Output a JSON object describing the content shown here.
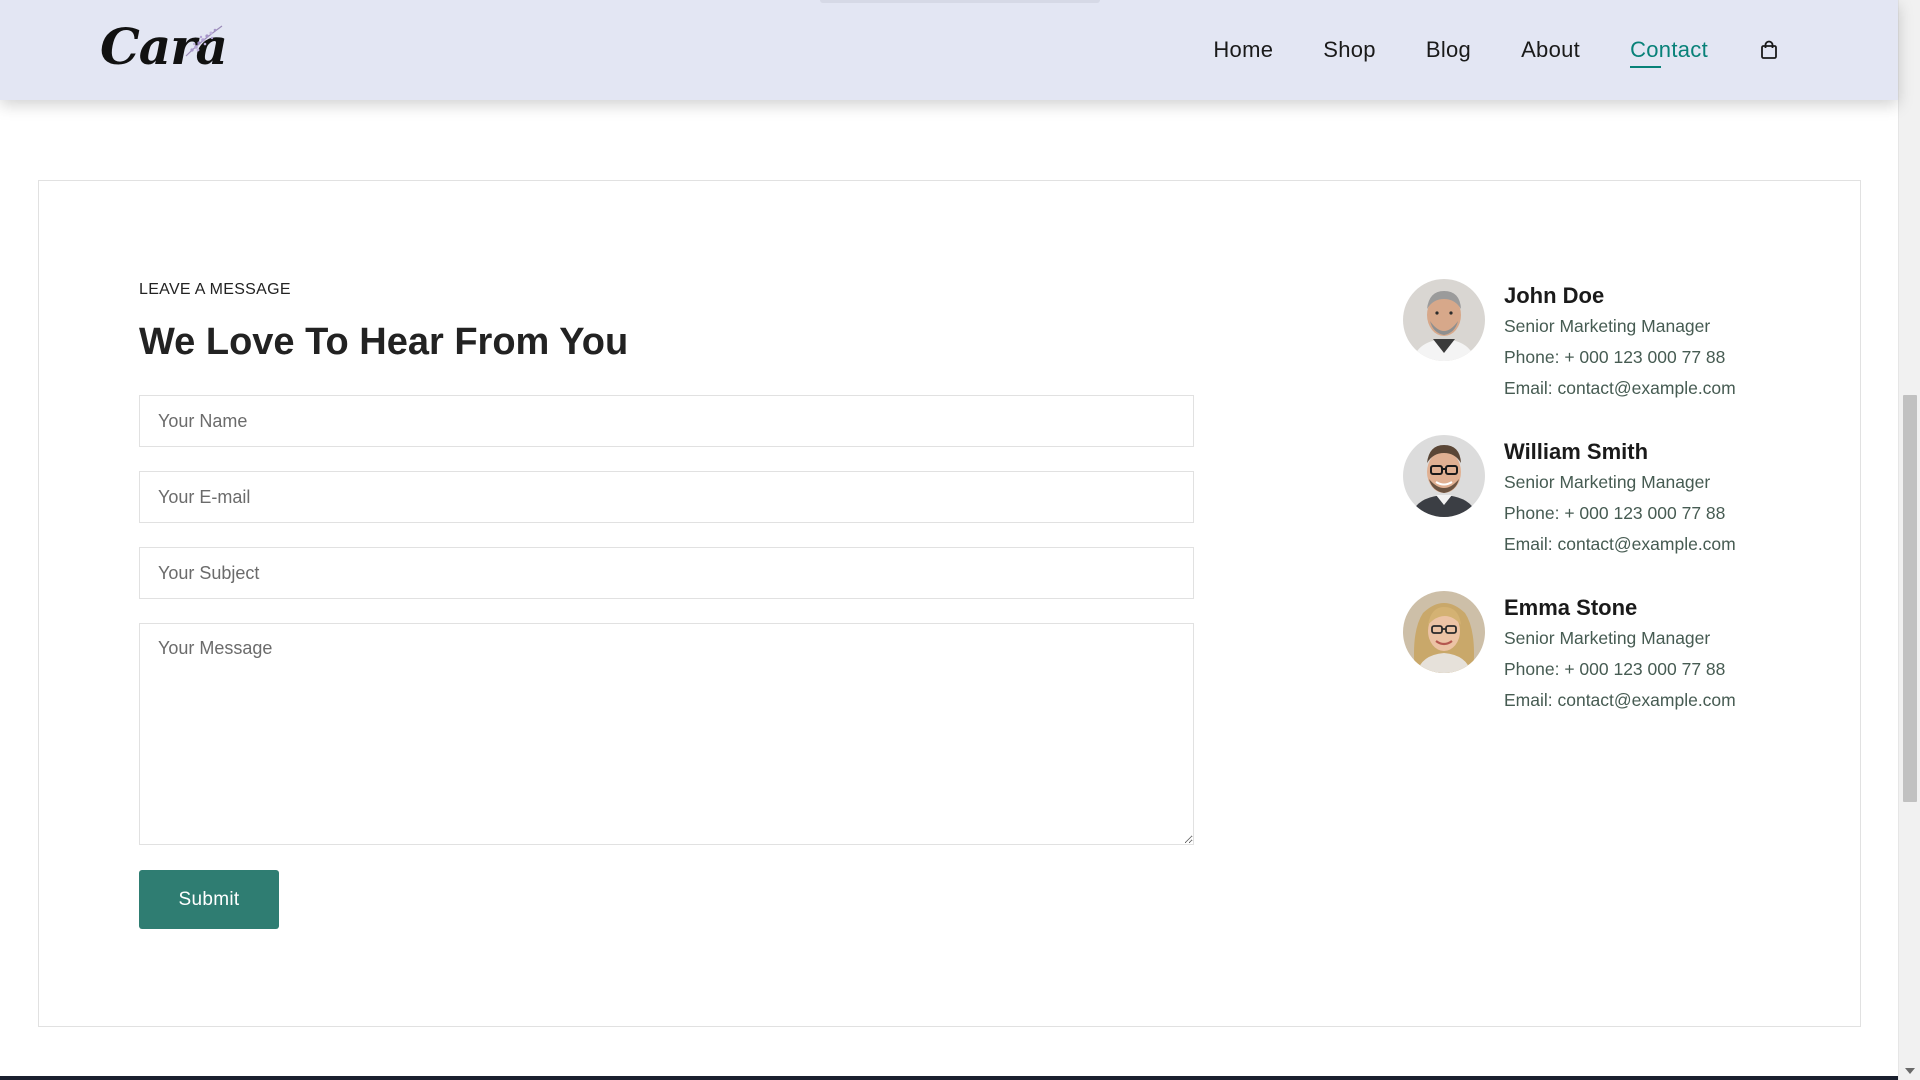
{
  "brand": {
    "logo_text": "Cara"
  },
  "nav": {
    "items": [
      {
        "label": "Home",
        "active": false
      },
      {
        "label": "Shop",
        "active": false
      },
      {
        "label": "Blog",
        "active": false
      },
      {
        "label": "About",
        "active": false
      },
      {
        "label": "Contact",
        "active": true
      }
    ],
    "cart_icon": "shopping-bag-icon"
  },
  "form": {
    "eyebrow": "LEAVE A MESSAGE",
    "title": "We Love To Hear From You",
    "name_placeholder": "Your Name",
    "email_placeholder": "Your E-mail",
    "subject_placeholder": "Your Subject",
    "message_placeholder": "Your Message",
    "submit_label": "Submit"
  },
  "people": [
    {
      "name": "John Doe",
      "role": "Senior Marketing Manager",
      "phone": "Phone: + 000 123 000 77 88",
      "email": "Email: contact@example.com"
    },
    {
      "name": "William Smith",
      "role": "Senior Marketing Manager",
      "phone": "Phone: + 000 123 000 77 88",
      "email": "Email: contact@example.com"
    },
    {
      "name": "Emma Stone",
      "role": "Senior Marketing Manager",
      "phone": "Phone: + 000 123 000 77 88",
      "email": "Email: contact@example.com"
    }
  ],
  "colors": {
    "header_bg": "#e3e6f3",
    "accent": "#088178",
    "submit_bg": "#2f7d72",
    "body_text": "#465b52"
  }
}
